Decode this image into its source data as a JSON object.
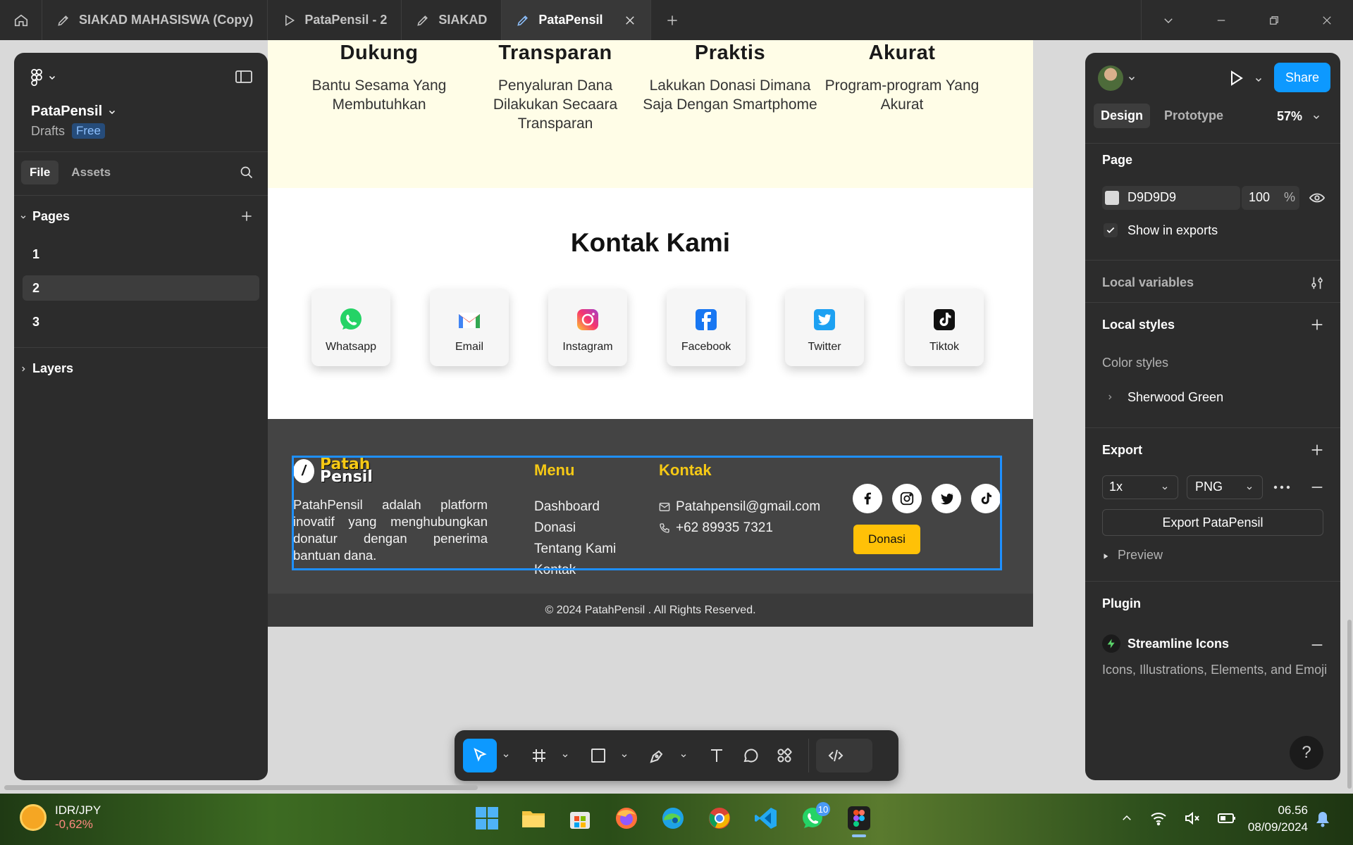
{
  "tabs": [
    {
      "label": "SIAKAD MAHASISWA (Copy)",
      "icon": "pen-icon"
    },
    {
      "label": "PataPensil - 2",
      "icon": "play-icon"
    },
    {
      "label": "SIAKAD",
      "icon": "pen-icon"
    },
    {
      "label": "PataPensil",
      "icon": "pen-icon",
      "active": true
    }
  ],
  "design": {
    "features": [
      {
        "title": "Dukung",
        "text": "Bantu Sesama Yang Membutuhkan"
      },
      {
        "title": "Transparan",
        "text": "Penyaluran Dana Dilakukan Secaara Transparan"
      },
      {
        "title": "Praktis",
        "text": "Lakukan Donasi Dimana Saja Dengan Smartphome"
      },
      {
        "title": "Akurat",
        "text": "Program-program Yang Akurat"
      }
    ],
    "contact_title": "Kontak Kami",
    "contacts": [
      "Whatsapp",
      "Email",
      "Instagram",
      "Facebook",
      "Twitter",
      "Tiktok"
    ],
    "footer": {
      "logo_line1": "Patah",
      "logo_line2": "Pensil",
      "about": "PatahPensil adalah platform inovatif yang menghubungkan donatur dengan penerima bantuan dana.",
      "menu_heading": "Menu",
      "menu": [
        "Dashboard",
        "Donasi",
        "Tentang Kami",
        "Kontak"
      ],
      "contact_heading": "Kontak",
      "email": "Patahpensil@gmail.com",
      "phone": "+62 89935 7321",
      "donate_button": "Donasi",
      "copyright": "© 2024 PatahPensil . All Rights Reserved."
    }
  },
  "left_panel": {
    "file_name": "PataPensil",
    "location": "Drafts",
    "plan": "Free",
    "tabs": [
      "File",
      "Assets"
    ],
    "pages_heading": "Pages",
    "pages": [
      "1",
      "2",
      "3"
    ],
    "selected_page": "2",
    "layers_heading": "Layers"
  },
  "right_panel": {
    "share_label": "Share",
    "tabs": [
      "Design",
      "Prototype"
    ],
    "zoom": "57%",
    "page_heading": "Page",
    "page_color": "D9D9D9",
    "page_opacity": "100",
    "percent": "%",
    "show_in_exports": "Show in exports",
    "local_variables": "Local variables",
    "local_styles": "Local styles",
    "color_styles": "Color styles",
    "style_name": "Sherwood Green",
    "export_heading": "Export",
    "export_scale": "1x",
    "export_format": "PNG",
    "export_button": "Export PataPensil",
    "preview": "Preview",
    "plugin_heading": "Plugin",
    "plugin_name": "Streamline Icons",
    "plugin_desc": "Icons, Illustrations, Elements, and Emoji",
    "help": "?"
  },
  "taskbar": {
    "widget_title": "IDR/JPY",
    "widget_value": "-0,62%",
    "whatsapp_badge": "10",
    "time": "06.56",
    "date": "08/09/2024"
  },
  "colors": {
    "accent": "#0d99ff",
    "footer_heading": "#f6c915",
    "donate": "#ffc107",
    "feature_bg": "#fffde7"
  }
}
